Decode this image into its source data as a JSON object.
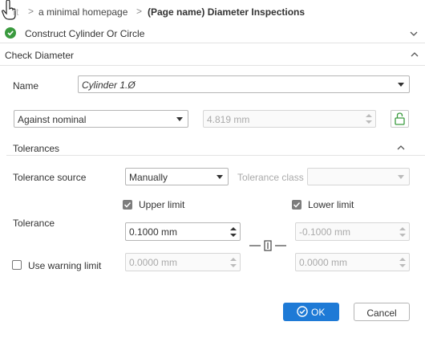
{
  "breadcrumb": {
    "items": [
      "rt",
      "a minimal homepage",
      "(Page name) Diameter Inspections"
    ],
    "separator": ">"
  },
  "header": {
    "title": "Construct Cylinder Or Circle"
  },
  "section": {
    "title": "Check Diameter",
    "name_label": "Name",
    "name_value": "Cylinder 1.Ø",
    "mode_value": "Against nominal",
    "nominal_value": "4.819 mm"
  },
  "tolerances": {
    "title": "Tolerances",
    "source_label": "Tolerance source",
    "source_value": "Manually",
    "class_label": "Tolerance class",
    "class_value": "",
    "upper_label": "Upper limit",
    "lower_label": "Lower limit",
    "tolerance_label": "Tolerance",
    "upper_value": "0.1000 mm",
    "lower_value": "-0.1000 mm",
    "warning_label": "Use warning limit",
    "warn_upper_value": "0.0000 mm",
    "warn_lower_value": "0.0000 mm"
  },
  "buttons": {
    "ok": "OK",
    "cancel": "Cancel"
  },
  "colors": {
    "accent": "#1e7ad6",
    "success": "#3a9a3e"
  }
}
